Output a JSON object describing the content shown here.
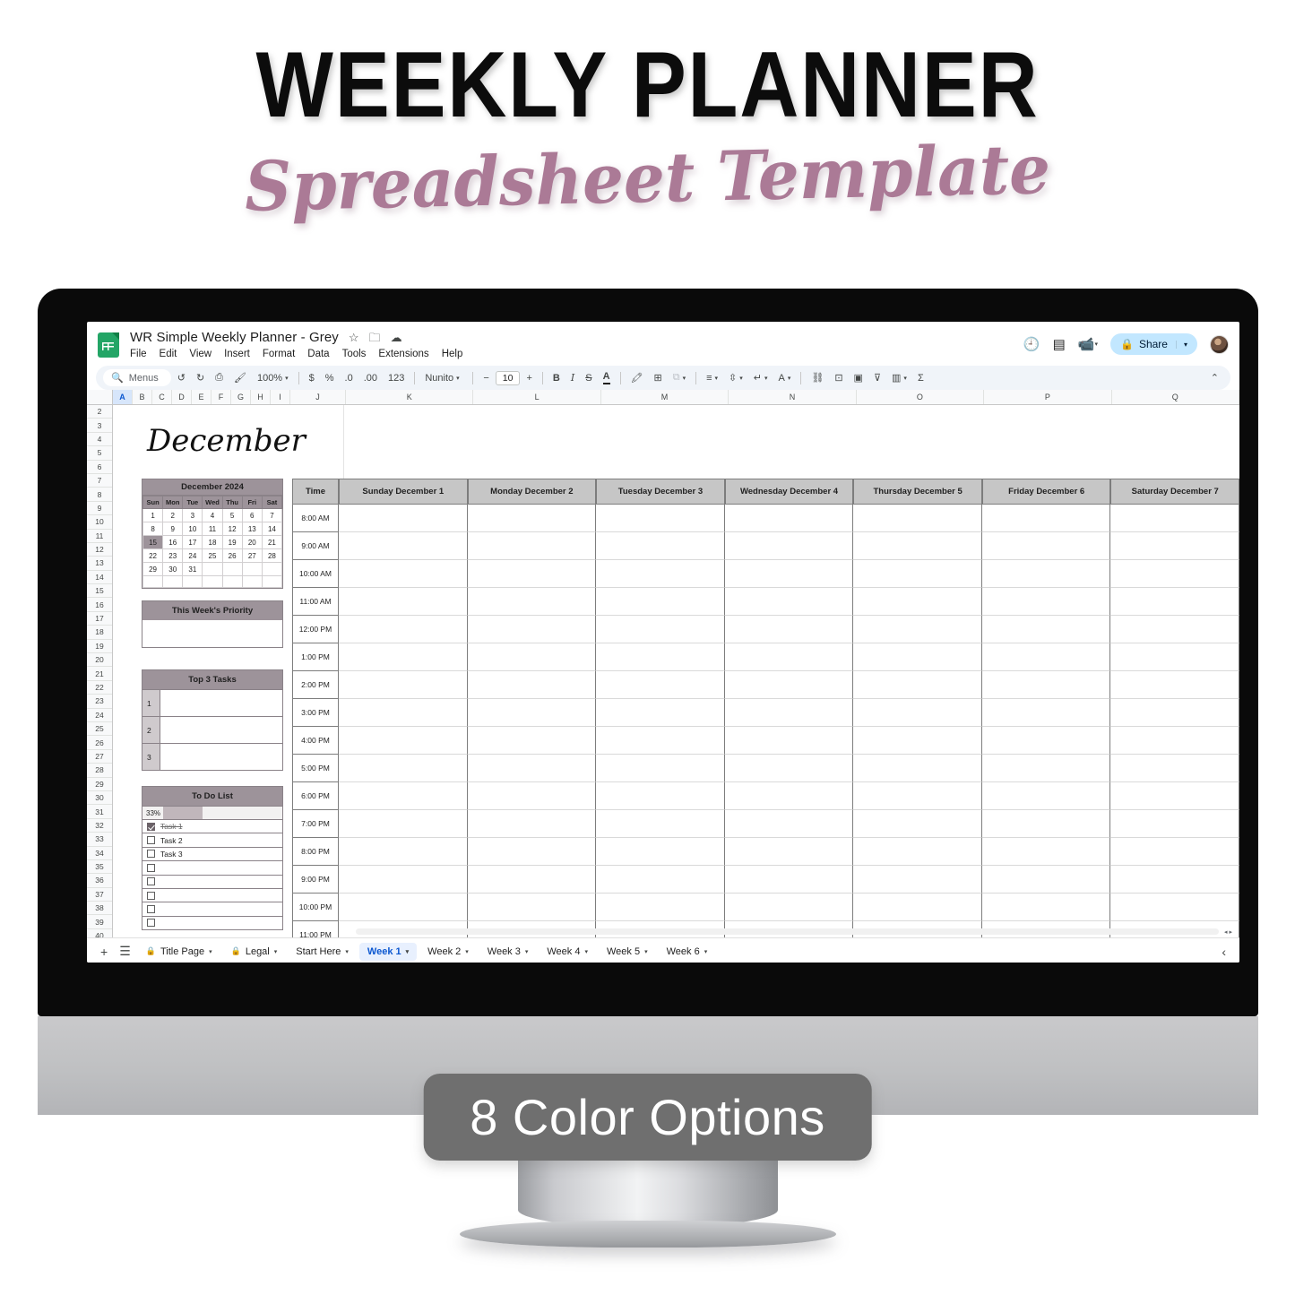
{
  "promo": {
    "title": "WEEKLY PLANNER",
    "subtitle": "Spreadsheet Template",
    "badge": "8 Color Options",
    "accent_color": "#ab7a96",
    "badge_color": "#6f6f6f"
  },
  "app": {
    "doc_name": "WR Simple Weekly Planner - Grey",
    "logo": "google-sheets-logo",
    "title_icons": [
      "star-icon",
      "move-to-folder-icon",
      "cloud-saved-icon"
    ],
    "menus": [
      "File",
      "Edit",
      "View",
      "Insert",
      "Format",
      "Data",
      "Tools",
      "Extensions",
      "Help"
    ],
    "right_icons": [
      "version-history-icon",
      "comment-icon",
      "meet-video-icon"
    ],
    "share_label": "Share",
    "share_icon": "lock-icon",
    "avatar": "user-avatar"
  },
  "toolbar": {
    "search_label": "Menus",
    "search_icon": "search-icon",
    "zoom": "100%",
    "font": "Nunito",
    "font_size": "10",
    "items": [
      {
        "icon": "undo-icon",
        "label": "↺"
      },
      {
        "icon": "redo-icon",
        "label": "↻"
      },
      {
        "icon": "print-icon",
        "label": "⎙"
      },
      {
        "icon": "paint-format-icon",
        "label": "⌨"
      },
      {
        "icon": "currency-icon",
        "label": "$"
      },
      {
        "icon": "percent-icon",
        "label": "%"
      },
      {
        "icon": "decrease-decimal-icon",
        "label": ".0"
      },
      {
        "icon": "increase-decimal-icon",
        "label": ".00"
      },
      {
        "icon": "more-formats-icon",
        "label": "123"
      },
      {
        "icon": "bold-icon",
        "label": "B"
      },
      {
        "icon": "italic-icon",
        "label": "I"
      },
      {
        "icon": "strikethrough-icon",
        "label": "S"
      },
      {
        "icon": "text-color-icon",
        "label": "A"
      },
      {
        "icon": "fill-color-icon",
        "label": "◗"
      },
      {
        "icon": "borders-icon",
        "label": "⊞"
      },
      {
        "icon": "merge-cells-icon",
        "label": "⧉"
      },
      {
        "icon": "horizontal-align-icon",
        "label": "≡"
      },
      {
        "icon": "vertical-align-icon",
        "label": "↕"
      },
      {
        "icon": "text-wrap-icon",
        "label": "↵"
      },
      {
        "icon": "text-rotation-icon",
        "label": "A"
      },
      {
        "icon": "insert-link-icon",
        "label": "🔗"
      },
      {
        "icon": "insert-comment-icon",
        "label": "⊞"
      },
      {
        "icon": "insert-chart-icon",
        "label": "▣"
      },
      {
        "icon": "create-filter-icon",
        "label": "⊽"
      },
      {
        "icon": "functions-icon",
        "label": "▤"
      },
      {
        "icon": "sum-icon",
        "label": "Σ"
      }
    ],
    "collapse_icon": "chevron-up-icon"
  },
  "grid": {
    "columns": [
      "A",
      "B",
      "C",
      "D",
      "E",
      "F",
      "G",
      "H",
      "I",
      "J",
      "K",
      "L",
      "M",
      "N",
      "O",
      "P",
      "Q"
    ],
    "selected_column": "A",
    "rows": [
      2,
      3,
      4,
      5,
      6,
      7,
      8,
      9,
      10,
      11,
      12,
      13,
      14,
      15,
      16,
      17,
      18,
      19,
      20,
      21,
      22,
      23,
      24,
      25,
      26,
      27,
      28,
      29,
      30,
      31,
      32,
      33,
      34,
      35,
      36,
      37,
      38,
      39,
      40
    ]
  },
  "sheet": {
    "month_title": "December",
    "calendar": {
      "title": "December 2024",
      "day_headers": [
        "Sun",
        "Mon",
        "Tue",
        "Wed",
        "Thu",
        "Fri",
        "Sat"
      ],
      "weeks": [
        [
          "1",
          "2",
          "3",
          "4",
          "5",
          "6",
          "7"
        ],
        [
          "8",
          "9",
          "10",
          "11",
          "12",
          "13",
          "14"
        ],
        [
          "15",
          "16",
          "17",
          "18",
          "19",
          "20",
          "21"
        ],
        [
          "22",
          "23",
          "24",
          "25",
          "26",
          "27",
          "28"
        ],
        [
          "29",
          "30",
          "31",
          "",
          "",
          "",
          ""
        ],
        [
          "",
          "",
          "",
          "",
          "",
          "",
          ""
        ]
      ],
      "highlighted_day": "15"
    },
    "priority": {
      "title": "This Week's Priority",
      "value": ""
    },
    "top3": {
      "title": "Top 3 Tasks",
      "rows": [
        {
          "num": "1",
          "value": ""
        },
        {
          "num": "2",
          "value": ""
        },
        {
          "num": "3",
          "value": ""
        }
      ]
    },
    "todo": {
      "title": "To Do List",
      "progress_pct": "33%",
      "progress_value": 33,
      "items": [
        {
          "label": "Task 1",
          "checked": true
        },
        {
          "label": "Task 2",
          "checked": false
        },
        {
          "label": "Task 3",
          "checked": false
        },
        {
          "label": "",
          "checked": false
        },
        {
          "label": "",
          "checked": false
        },
        {
          "label": "",
          "checked": false
        },
        {
          "label": "",
          "checked": false
        },
        {
          "label": "",
          "checked": false
        }
      ]
    },
    "schedule": {
      "time_header": "Time",
      "days": [
        "Sunday December 1",
        "Monday December 2",
        "Tuesday December 3",
        "Wednesday December 4",
        "Thursday December 5",
        "Friday December 6",
        "Saturday December 7"
      ],
      "times": [
        "8:00 AM",
        "9:00 AM",
        "10:00 AM",
        "11:00 AM",
        "12:00 PM",
        "1:00 PM",
        "2:00 PM",
        "3:00 PM",
        "4:00 PM",
        "5:00 PM",
        "6:00 PM",
        "7:00 PM",
        "8:00 PM",
        "9:00 PM",
        "10:00 PM",
        "11:00 PM"
      ]
    },
    "header_fill": "#9d939a",
    "schedule_header_fill": "#c6c6c6"
  },
  "sheet_tabs": {
    "add_icon": "add-sheet-icon",
    "list_icon": "all-sheets-icon",
    "tabs": [
      {
        "label": "Title Page",
        "locked": true,
        "active": false
      },
      {
        "label": "Legal",
        "locked": true,
        "active": false
      },
      {
        "label": "Start Here",
        "locked": false,
        "active": false
      },
      {
        "label": "Week 1",
        "locked": false,
        "active": true
      },
      {
        "label": "Week 2",
        "locked": false,
        "active": false
      },
      {
        "label": "Week 3",
        "locked": false,
        "active": false
      },
      {
        "label": "Week 4",
        "locked": false,
        "active": false
      },
      {
        "label": "Week 5",
        "locked": false,
        "active": false
      },
      {
        "label": "Week 6",
        "locked": false,
        "active": false
      }
    ],
    "collapse_icon": "chevron-left-icon"
  }
}
